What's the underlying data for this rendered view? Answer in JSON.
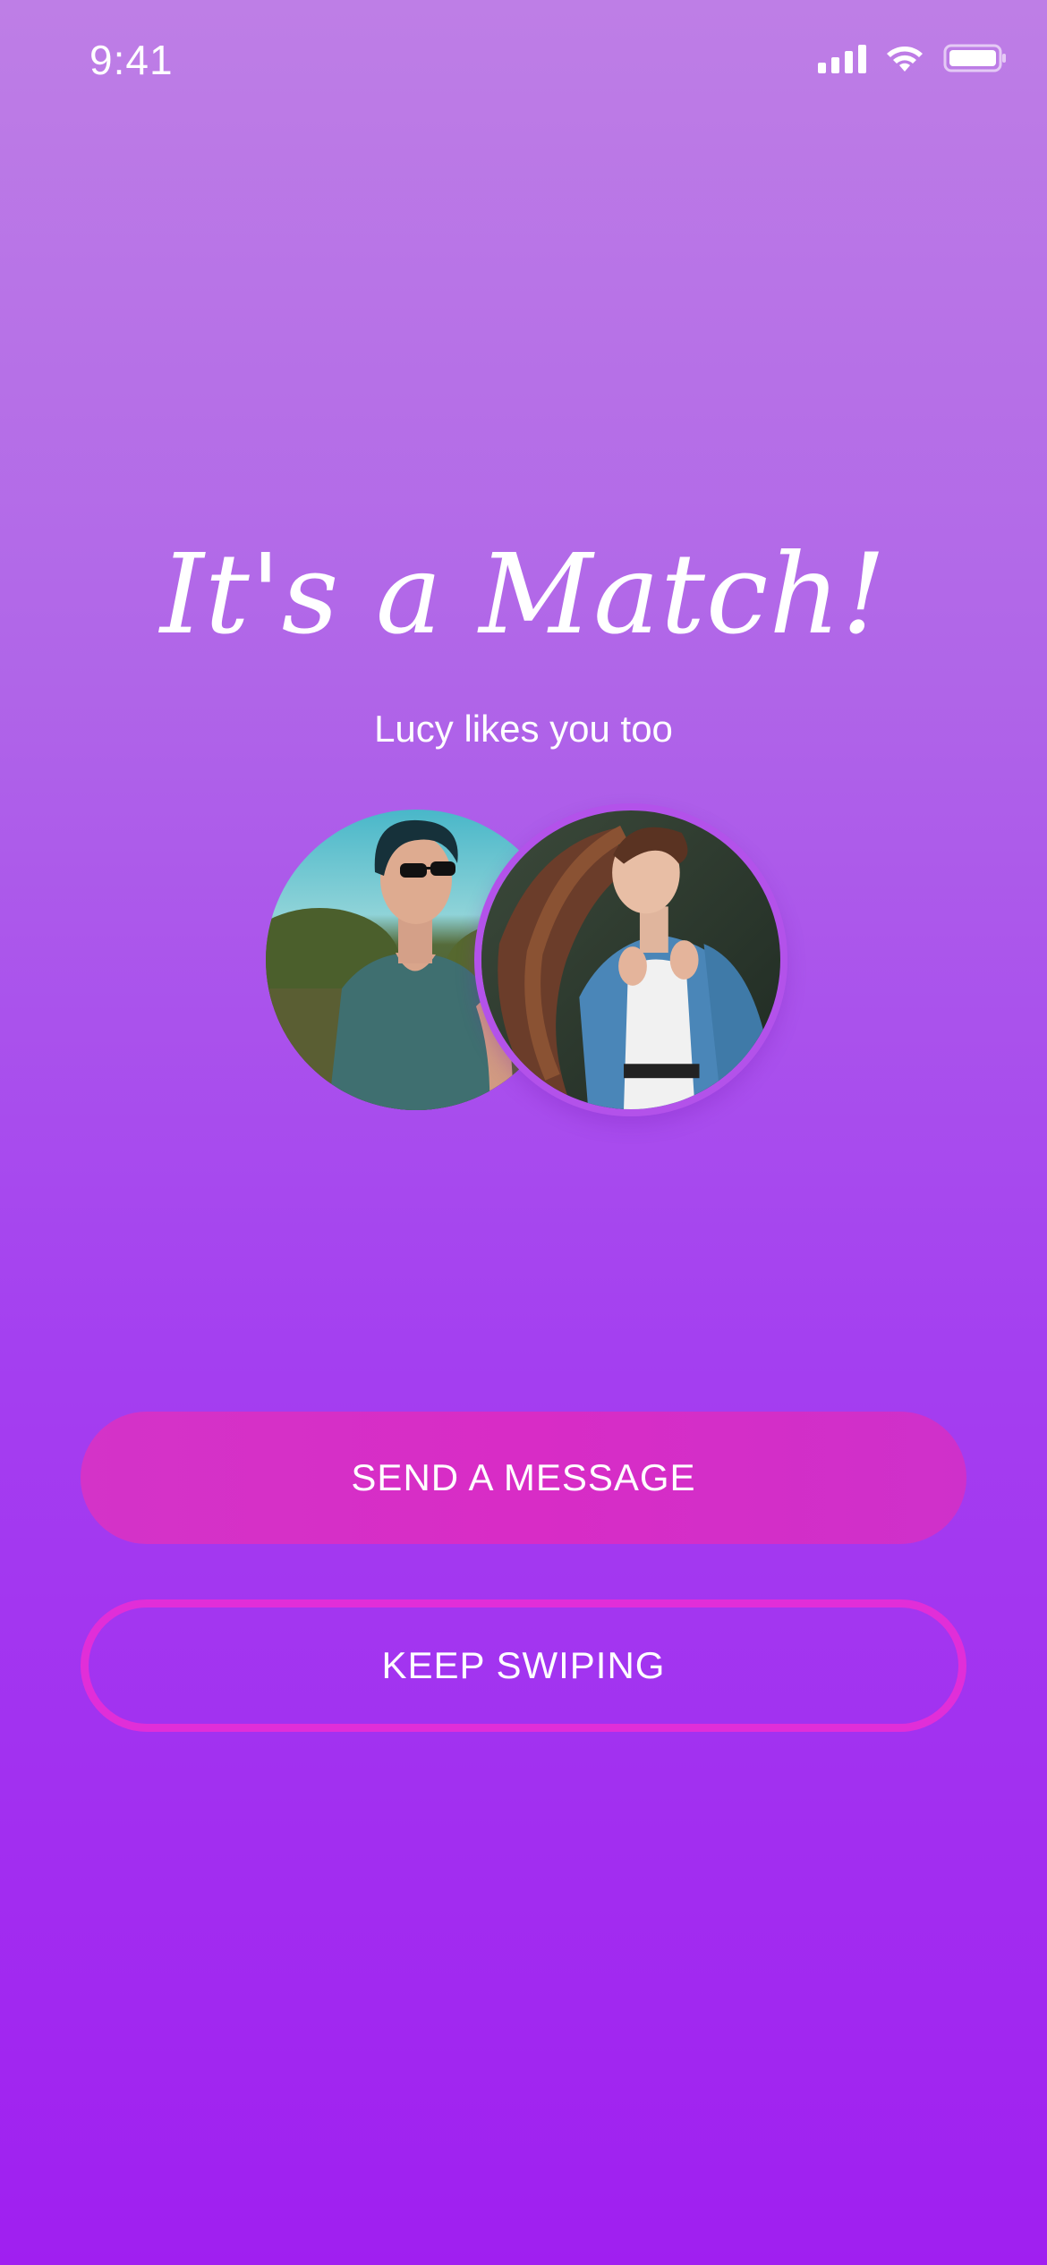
{
  "status_bar": {
    "time": "9:41",
    "icons": [
      "signal-icon",
      "wifi-icon",
      "battery-icon"
    ]
  },
  "match": {
    "title": "It's a Match!",
    "subtitle": "Lucy likes you too"
  },
  "avatars": {
    "left": "man-profile-photo",
    "right": "woman-profile-photo"
  },
  "actions": {
    "send_message": "SEND A MESSAGE",
    "keep_swiping": "KEEP SWIPING"
  },
  "colors": {
    "background_top": "#be7ee6",
    "background_bottom": "#a01ff0",
    "primary_button": "#d82cc6",
    "secondary_border": "#e12ed8",
    "text": "#ffffff"
  }
}
